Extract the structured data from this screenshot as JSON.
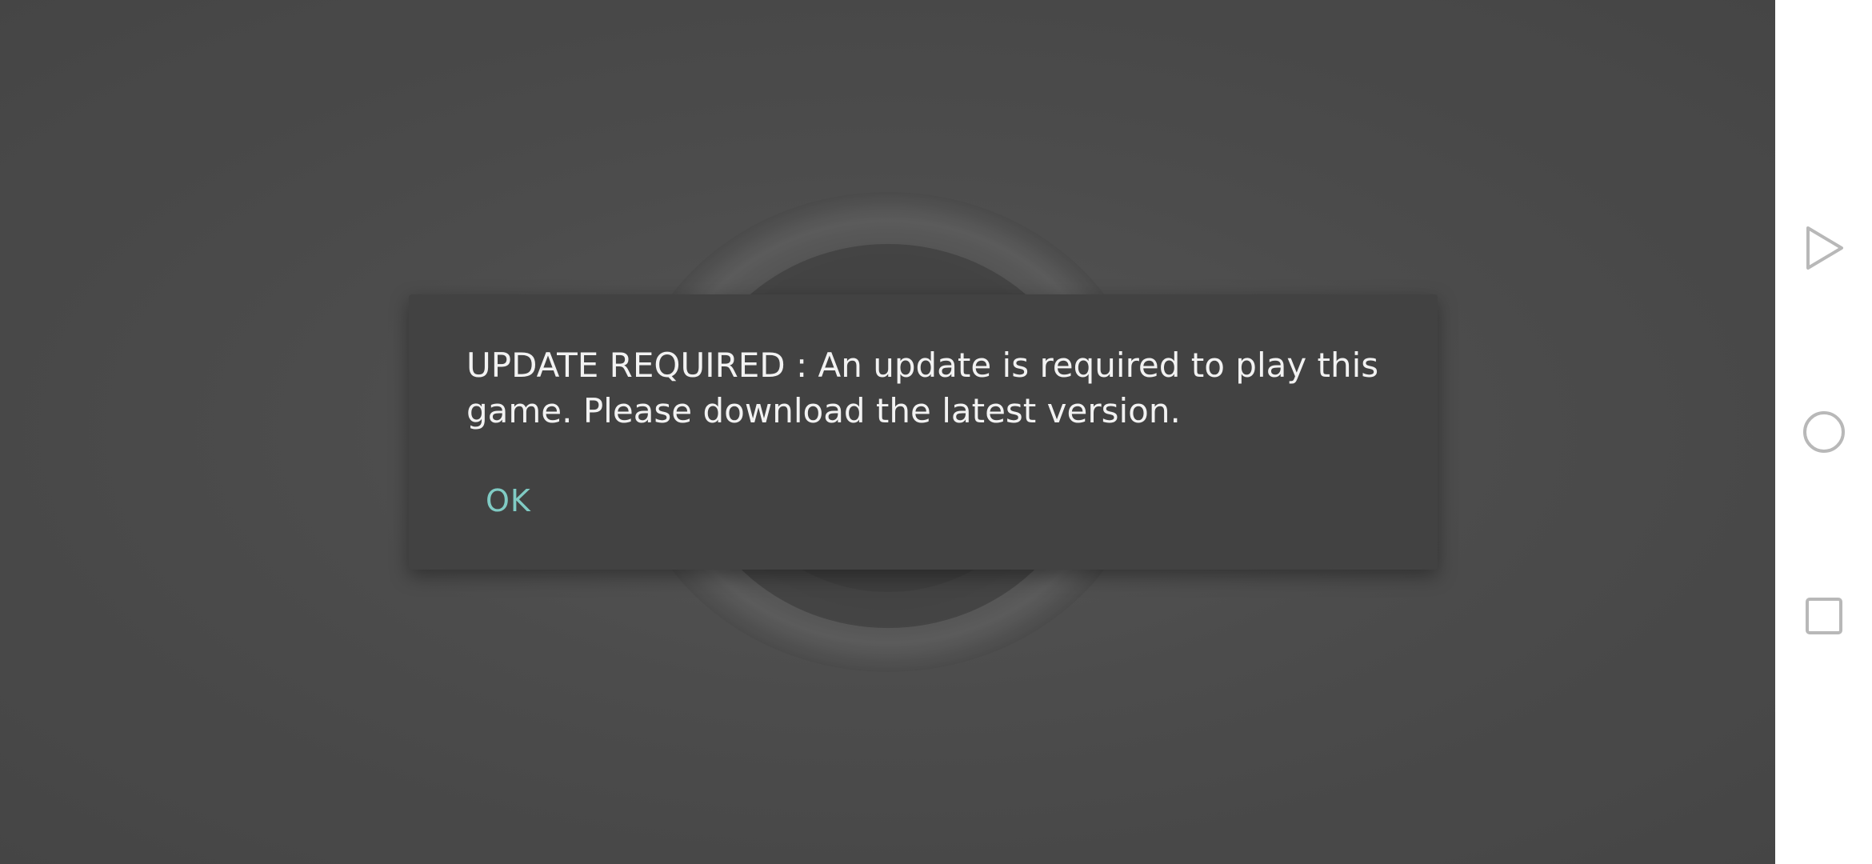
{
  "dialog": {
    "message": "UPDATE REQUIRED : An update is required to play this game. Please download the latest version.",
    "ok_label": "OK"
  },
  "navbar": {
    "back_icon": "back-triangle-icon",
    "home_icon": "home-circle-icon",
    "recents_icon": "recents-square-icon"
  },
  "colors": {
    "dialog_background": "#424242",
    "accent": "#80cbc4",
    "navbar_icon": "#b8b8b8"
  }
}
